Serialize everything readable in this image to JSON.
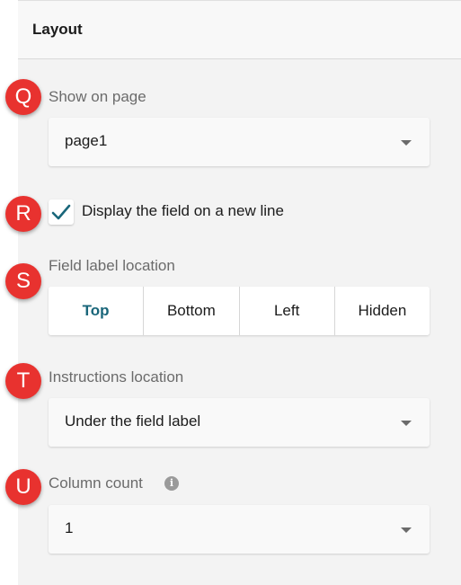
{
  "panel": {
    "title": "Layout"
  },
  "badges": [
    "Q",
    "R",
    "S",
    "T",
    "U"
  ],
  "show_on_page": {
    "label": "Show on page",
    "value": "page1"
  },
  "new_line": {
    "label": "Display the field on a new line",
    "checked": true
  },
  "field_label_location": {
    "label": "Field label location",
    "options": [
      "Top",
      "Bottom",
      "Left",
      "Hidden"
    ],
    "selected": "Top"
  },
  "instructions_location": {
    "label": "Instructions location",
    "value": "Under the field label"
  },
  "column_count": {
    "label": "Column count",
    "value": "1"
  },
  "colors": {
    "accent": "#19667a",
    "badge": "#e8322f",
    "checkmark": "#19667a"
  }
}
